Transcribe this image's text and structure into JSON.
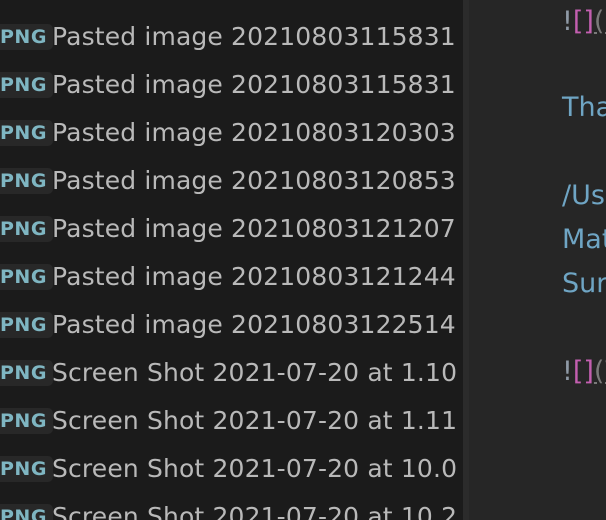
{
  "explorer": {
    "files": [
      {
        "badge": "PNG",
        "name": "Pasted image 20210803115831"
      },
      {
        "badge": "PNG",
        "name": "Pasted image 20210803115831"
      },
      {
        "badge": "PNG",
        "name": "Pasted image 20210803120303"
      },
      {
        "badge": "PNG",
        "name": "Pasted image 20210803120853"
      },
      {
        "badge": "PNG",
        "name": "Pasted image 20210803121207"
      },
      {
        "badge": "PNG",
        "name": "Pasted image 20210803121244"
      },
      {
        "badge": "PNG",
        "name": "Pasted image 20210803122514"
      },
      {
        "badge": "PNG",
        "name": "Screen Shot 2021-07-20 at 1.10"
      },
      {
        "badge": "PNG",
        "name": "Screen Shot 2021-07-20 at 1.11"
      },
      {
        "badge": "PNG",
        "name": "Screen Shot 2021-07-20 at 10.0"
      },
      {
        "badge": "PNG",
        "name": "Screen Shot 2021-07-20 at 10.2"
      }
    ]
  },
  "editor": {
    "line1": {
      "bang": "!",
      "open": "[",
      "close": "]",
      "link": "(P"
    },
    "line2": "Tha",
    "line3": "/Us",
    "line4": "Mat",
    "line5": "Sur",
    "line6": {
      "bang": "!",
      "open": "[",
      "close": "]",
      "link": "(W"
    },
    "colors": {
      "text": "#6fa5c4",
      "bracket": "#c35fb0",
      "badge": "#7fb6c2"
    }
  }
}
